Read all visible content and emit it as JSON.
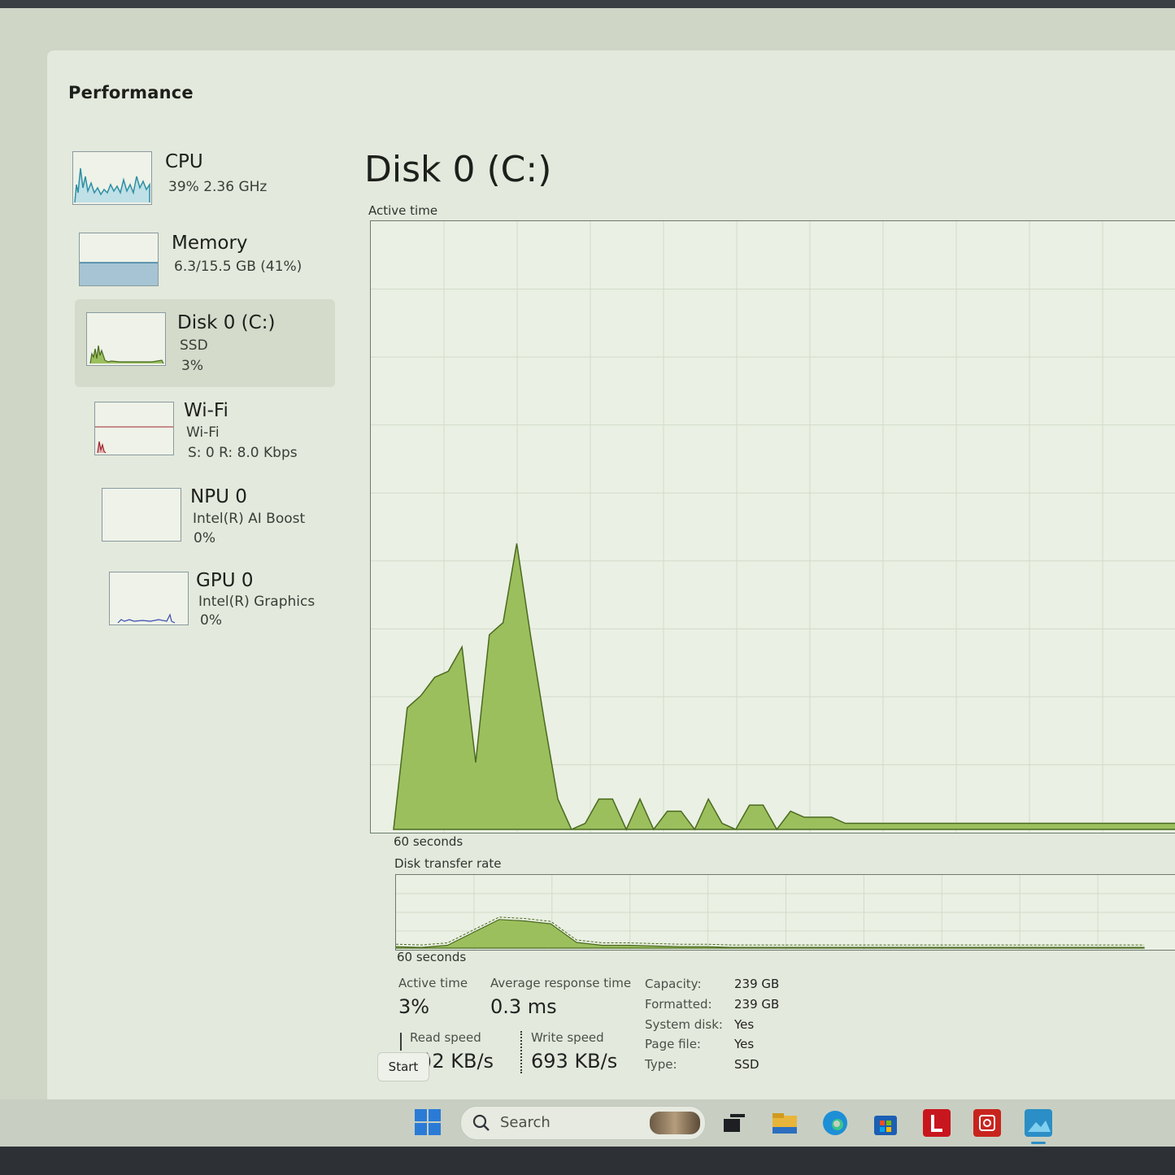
{
  "window": {
    "title": "Performance"
  },
  "sidebar": {
    "items": [
      {
        "name": "CPU",
        "line1": "39%  2.36 GHz",
        "line2": ""
      },
      {
        "name": "Memory",
        "line1": "6.3/15.5 GB (41%)",
        "line2": ""
      },
      {
        "name": "Disk 0 (C:)",
        "line1": "SSD",
        "line2": "3%"
      },
      {
        "name": "Wi-Fi",
        "line1": "Wi-Fi",
        "line2": "S: 0  R: 8.0 Kbps"
      },
      {
        "name": "NPU 0",
        "line1": "Intel(R) AI Boost",
        "line2": "0%"
      },
      {
        "name": "GPU 0",
        "line1": "Intel(R) Graphics",
        "line2": "0%"
      }
    ]
  },
  "main": {
    "title": "Disk 0 (C:)",
    "active_chart_label": "Active time",
    "active_chart_xlabel": "60 seconds",
    "transfer_chart_label": "Disk transfer rate",
    "transfer_chart_xlabel": "60 seconds"
  },
  "stats": {
    "active_time_label": "Active time",
    "active_time_value": "3%",
    "avg_response_label": "Average response time",
    "avg_response_value": "0.3 ms",
    "read_label": "Read speed",
    "read_value": ")2 KB/s",
    "write_label": "Write speed",
    "write_value": "693 KB/s"
  },
  "properties": [
    {
      "label": "Capacity:",
      "value": "239 GB"
    },
    {
      "label": "Formatted:",
      "value": "239 GB"
    },
    {
      "label": "System disk:",
      "value": "Yes"
    },
    {
      "label": "Page file:",
      "value": "Yes"
    },
    {
      "label": "Type:",
      "value": "SSD"
    }
  ],
  "taskbar": {
    "start_tooltip": "Start",
    "search_placeholder": "Search",
    "icons": [
      "windows-start-icon",
      "task-view-icon",
      "file-explorer-icon",
      "edge-icon",
      "store-icon",
      "lenovo-icon",
      "red-app-icon",
      "photos-icon"
    ]
  },
  "colors": {
    "disk_fill": "#9cbf5e",
    "disk_line": "#4a6a1f",
    "cpu_line": "#2e8fa5",
    "memory_fill": "#a6c4d3",
    "wifi_line": "#a0262a",
    "gpu_line": "#3b4bb0"
  },
  "chart_data": [
    {
      "type": "area",
      "title": "Active time",
      "xlabel": "60 seconds",
      "ylim": [
        0,
        100
      ],
      "x": [
        60,
        59,
        58,
        57,
        56,
        55,
        54,
        53,
        52,
        51,
        50,
        49,
        48,
        47,
        46,
        45,
        44,
        43,
        42,
        41,
        40,
        39,
        38,
        37,
        36,
        35,
        34,
        33,
        32,
        31,
        31,
        30,
        29,
        28,
        27,
        26,
        25,
        24,
        23,
        22,
        21,
        20,
        19,
        18,
        17,
        16,
        15,
        14,
        13,
        12,
        11,
        10,
        9,
        8,
        7,
        6,
        5,
        4,
        3,
        2,
        1,
        0
      ],
      "values": [
        0,
        20,
        22,
        25,
        26,
        30,
        11,
        32,
        34,
        47,
        32,
        18,
        5,
        0,
        1,
        5,
        5,
        0,
        5,
        0,
        3,
        3,
        0,
        5,
        1,
        0,
        4,
        4,
        0,
        3,
        3,
        2,
        2,
        2,
        1,
        1,
        1,
        1,
        1,
        1,
        1,
        1,
        1,
        1,
        1,
        1,
        1,
        1,
        1,
        1,
        1,
        1,
        1,
        1,
        1,
        1,
        1,
        1,
        1,
        1,
        1,
        4
      ]
    },
    {
      "type": "area",
      "title": "Disk transfer rate",
      "xlabel": "60 seconds",
      "series": [
        {
          "values": [
            2,
            1,
            4,
            22,
            40,
            38,
            34,
            8,
            4,
            4,
            3,
            2,
            2,
            1,
            1,
            1,
            1,
            1,
            1,
            1,
            1,
            1,
            1,
            1,
            1,
            1,
            1,
            1,
            1,
            1
          ]
        }
      ]
    }
  ]
}
